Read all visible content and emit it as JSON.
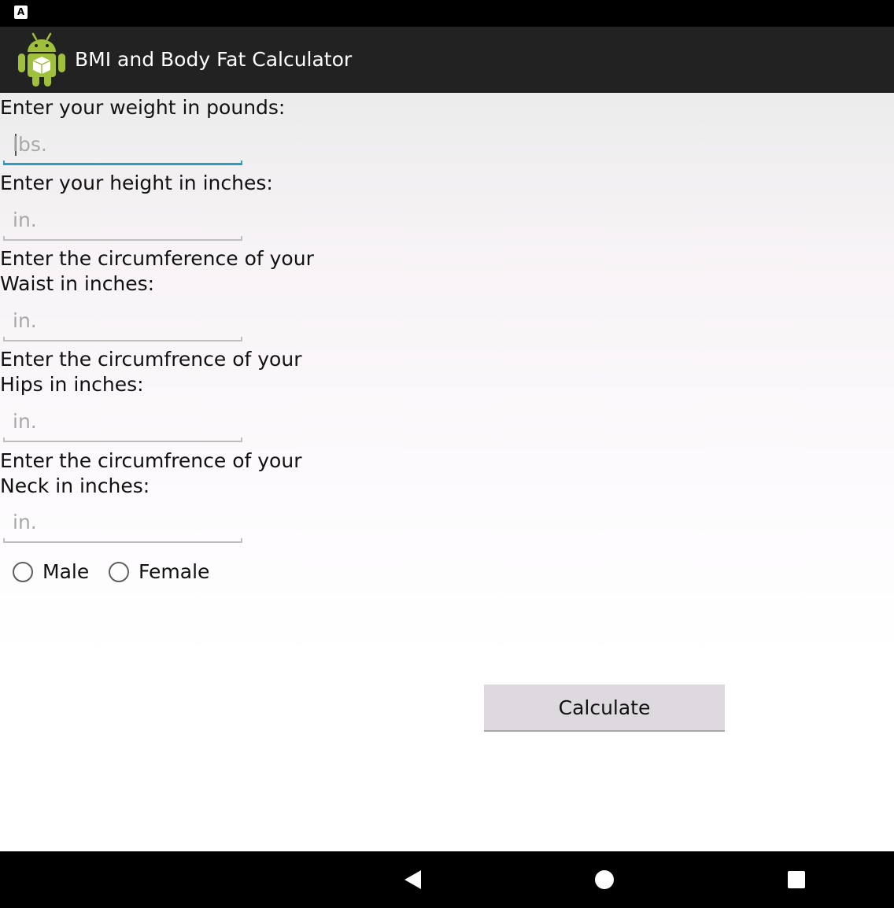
{
  "status_bar": {
    "notification_glyph": "A"
  },
  "app": {
    "title": "BMI and Body Fat Calculator",
    "icon": "android-robot-icon"
  },
  "form": {
    "weight": {
      "label": "Enter your weight in pounds:",
      "placeholder": "lbs.",
      "value": ""
    },
    "height": {
      "label": "Enter your height in inches:",
      "placeholder": "in.",
      "value": ""
    },
    "waist": {
      "label": "Enter the circumference of your Waist in inches:",
      "placeholder": "in.",
      "value": ""
    },
    "hips": {
      "label": "Enter the circumfrence of your Hips in inches:",
      "placeholder": "in.",
      "value": ""
    },
    "neck": {
      "label": "Enter the circumfrence of your Neck in inches:",
      "placeholder": "in.",
      "value": ""
    },
    "gender": {
      "male_label": "Male",
      "female_label": "Female",
      "selected": null
    },
    "calculate_label": "Calculate"
  },
  "nav_bar": {
    "back": "back-triangle-icon",
    "home": "home-circle-icon",
    "recents": "recents-square-icon"
  },
  "colors": {
    "action_bar": "#222222",
    "focus_accent": "#2a9fc4",
    "android_green": "#9fc03b",
    "button_bg": "#ddd9de"
  }
}
